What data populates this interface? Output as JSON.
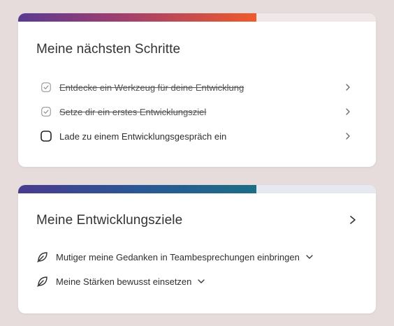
{
  "steps_card": {
    "title": "Meine nächsten Schritte",
    "progress_fraction": 0.666,
    "steps": [
      {
        "label": "Entdecke ein Werkzeug für deine Entwicklung",
        "done": true
      },
      {
        "label": "Setze dir ein erstes Entwicklungsziel",
        "done": true
      },
      {
        "label": "Lade zu einem Entwicklungsgespräch ein",
        "done": false
      }
    ]
  },
  "goals_card": {
    "title": "Meine Entwicklungsziele",
    "progress_fraction": 0.666,
    "goals": [
      {
        "label": "Mutiger meine Gedanken in Teambesprechungen einbringen",
        "icon": "leaf-icon"
      },
      {
        "label": "Meine Stärken bewusst einsetzen",
        "icon": "leaf-icon"
      }
    ]
  },
  "colors": {
    "background": "#e5dcdb",
    "steps_progress_gradient": [
      "#5b3a91",
      "#a33f6e",
      "#ef5a2a"
    ],
    "goals_progress_gradient": [
      "#4a3a8f",
      "#2a5795",
      "#1c6e86"
    ]
  }
}
